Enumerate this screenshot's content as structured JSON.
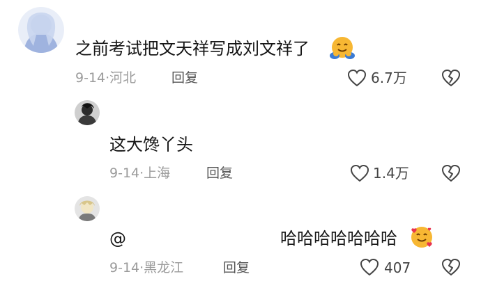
{
  "comments": [
    {
      "text": "之前考试把文天祥写成刘文祥了",
      "emoji": "hugging-face-emoji",
      "date": "9-14",
      "location": "河北",
      "reply_label": "回复",
      "likes": "6.7万"
    },
    {
      "text": "这大馋丫头",
      "date": "9-14",
      "location": "上海",
      "reply_label": "回复",
      "likes": "1.4万"
    },
    {
      "text_prefix": "@",
      "text": "哈哈哈哈哈哈哈",
      "emoji": "smiling-face-with-hearts-emoji",
      "date": "9-14",
      "location": "黑龙江",
      "reply_label": "回复",
      "likes": "407"
    }
  ],
  "meta_separator": "·"
}
